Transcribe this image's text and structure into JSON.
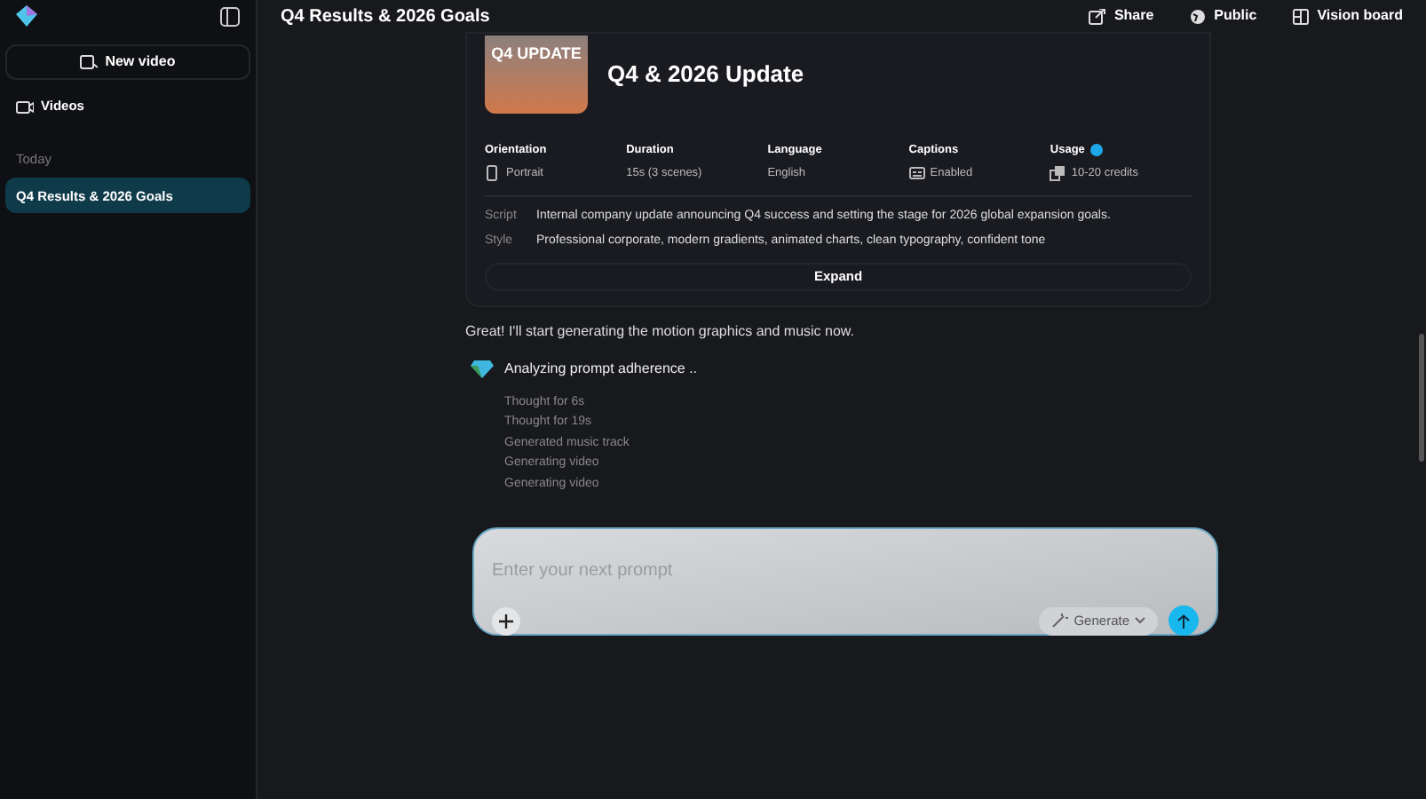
{
  "sidebar": {
    "new_video": "New video",
    "items": [
      {
        "label": "Videos",
        "selected": false
      }
    ],
    "section": "Today",
    "history": [
      {
        "label": "Q4 Results & 2026 Goals",
        "selected": true
      }
    ]
  },
  "header": {
    "title": "Q4 Results & 2026 Goals",
    "actions": [
      {
        "kind": "share",
        "label": "Share"
      },
      {
        "kind": "public",
        "label": "Public"
      },
      {
        "kind": "board",
        "label": "Vision board"
      }
    ]
  },
  "card": {
    "thumbnail_text": "Q4 UPDATE",
    "title": "Q4 & 2026 Update",
    "specs": [
      {
        "kind": "portrait",
        "label": "Orientation",
        "value": "Portrait",
        "info": false
      },
      {
        "kind": "none",
        "label": "Duration",
        "value": "15s (3 scenes)",
        "info": false
      },
      {
        "kind": "none",
        "label": "Language",
        "value": "English",
        "info": false
      },
      {
        "kind": "captions",
        "label": "Captions",
        "value": "Enabled",
        "info": false
      },
      {
        "kind": "credits",
        "label": "Usage",
        "value": "10-20 credits",
        "info": true
      }
    ],
    "details": [
      {
        "label": "Script",
        "text": "Internal company update announcing Q4 success and setting the stage for 2026 global expansion goals."
      },
      {
        "label": "Style",
        "text": "Professional corporate, modern gradients, animated charts, clean typography, confident tone"
      }
    ],
    "expand": "Expand"
  },
  "message": "Great! I'll start generating the motion graphics and music now.",
  "status": {
    "title": "Analyzing prompt adherence ..",
    "steps": [
      "Thought for 6s",
      "Thought for 19s",
      "Generated music track",
      "Generating video",
      "Generating video"
    ]
  },
  "prompt": {
    "placeholder": "Enter your next prompt",
    "mode": "Generate"
  }
}
